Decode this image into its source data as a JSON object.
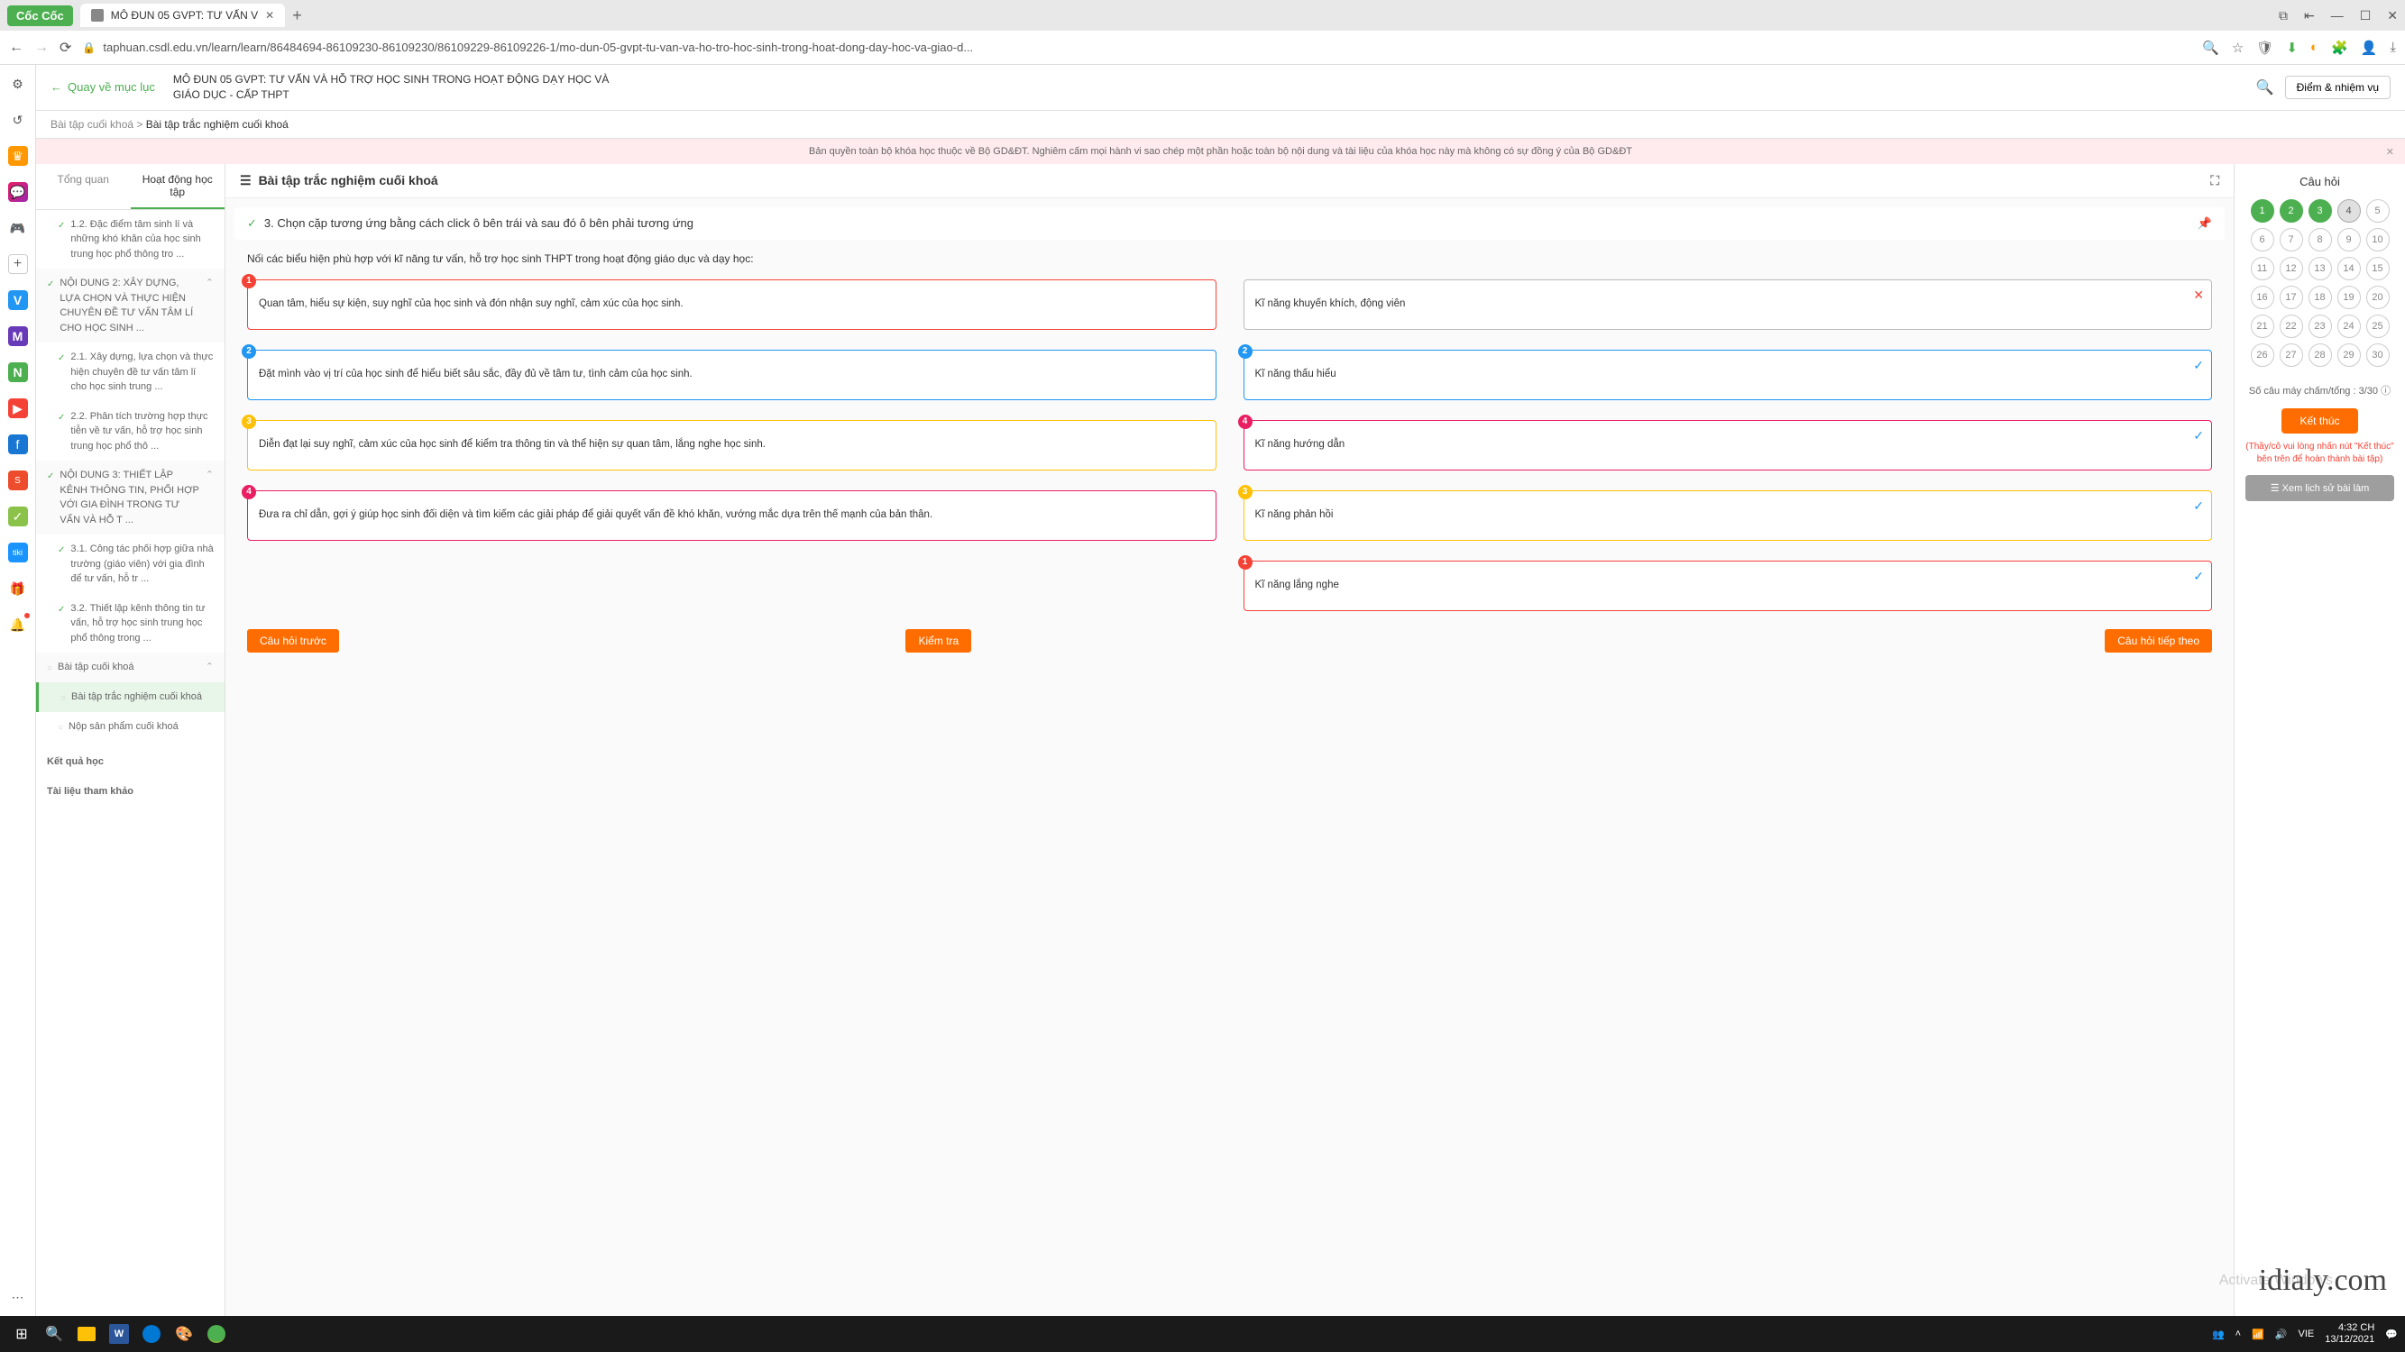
{
  "browser": {
    "logo": "Cốc Cốc",
    "tab_title": "MÔ ĐUN 05 GVPT: TƯ VẤN V",
    "url": "taphuan.csdl.edu.vn/learn/learn/86484694-86109230-86109230/86109229-86109226-1/mo-dun-05-gvpt-tu-van-va-ho-tro-hoc-sinh-trong-hoat-dong-day-hoc-va-giao-d..."
  },
  "header": {
    "back": "Quay về mục lục",
    "title": "MÔ ĐUN 05 GVPT: TƯ VẤN VÀ HỖ TRỢ HỌC SINH TRONG HOẠT ĐỘNG DẠY HỌC VÀ GIÁO DỤC - CẤP THPT",
    "score_btn": "Điểm & nhiệm vụ"
  },
  "breadcrumb": {
    "a": "Bài tập cuối khoá",
    "b": "Bài tập trắc nghiệm cuối khoá"
  },
  "warning": "Bản quyền toàn bộ khóa học thuộc về Bộ GD&ĐT. Nghiêm cấm mọi hành vi sao chép một phần hoặc toàn bộ nội dung và tài liệu của khóa học này mà không có sự đồng ý của Bộ GD&ĐT",
  "nav": {
    "tab1": "Tổng quan",
    "tab2": "Hoạt động học tập",
    "items": [
      "1.2. Đặc điểm tâm sinh lí và những khó khăn của học sinh trung học phổ thông tro ...",
      "NỘI DUNG 2: XÂY DỰNG, LỰA CHỌN VÀ THỰC HIỆN CHUYÊN ĐỀ TƯ VẤN TÂM LÍ CHO HỌC SINH ...",
      "2.1. Xây dựng, lựa chọn và thực hiện chuyên đề tư vấn tâm lí cho học sinh trung ...",
      "2.2. Phân tích trường hợp thực tiễn về tư vấn, hỗ trợ học sinh trung học phổ thô ...",
      "NỘI DUNG 3: THIẾT LẬP KÊNH THÔNG TIN, PHỐI HỢP VỚI GIA ĐÌNH TRONG TƯ VẤN VÀ HỖ T ...",
      "3.1. Công tác phối hợp giữa nhà trường (giáo viên) với gia đình để tư vấn, hỗ tr ...",
      "3.2. Thiết lập kênh thông tin tư vấn, hỗ trợ học sinh trung học phổ thông trong ...",
      "Bài tập cuối khoá",
      "Bài tập trắc nghiệm cuối khoá",
      "Nộp sản phẩm cuối khoá",
      "Kết quả học",
      "Tài liệu tham khảo"
    ]
  },
  "quiz": {
    "title": "Bài tập trắc nghiệm cuối khoá",
    "q_header": "3. Chọn cặp tương ứng bằng cách click ô bên trái và sau đó ô bên phải tương ứng",
    "q_text": "Nối các biểu hiện phù hợp với kĩ năng tư vấn, hỗ trợ học sinh THPT trong hoạt động giáo dục và dạy học:",
    "left": [
      "Quan tâm, hiểu sự kiện, suy nghĩ của học sinh và đón nhận suy nghĩ, cảm xúc của học sinh.",
      "Đặt mình vào vị trí của học sinh để hiểu biết sâu sắc, đầy đủ về tâm tư, tình cảm của học sinh.",
      "Diễn đạt lại suy nghĩ, cảm xúc của học sinh để kiểm tra thông tin và thể hiện sự quan tâm, lắng nghe học sinh.",
      "Đưa ra chỉ dẫn, gợi ý giúp học sinh đối diện và tìm kiếm các giải pháp để giải quyết vấn đề khó khăn, vướng mắc dựa trên thế mạnh của bản thân."
    ],
    "right": [
      "Kĩ năng khuyến khích, động viên",
      "Kĩ năng thấu hiểu",
      "Kĩ năng hướng dẫn",
      "Kĩ năng phản hồi",
      "Kĩ năng lắng nghe"
    ],
    "btn_prev": "Câu hỏi trước",
    "btn_check": "Kiểm tra",
    "btn_next": "Câu hỏi tiếp theo"
  },
  "right": {
    "title": "Câu hỏi",
    "score": "Số câu máy chấm/tổng : 3/30",
    "finish": "Kết thúc",
    "note": "(Thầy/cô vui lòng nhấn nút \"Kết thúc\" bên trên để hoàn thành bài tập)",
    "history": "☰ Xem lịch sử bài làm"
  },
  "watermark": "idialy.com",
  "activate": "Activate Windows",
  "taskbar": {
    "lang": "VIE",
    "time": "4:32 CH",
    "date": "13/12/2021"
  }
}
